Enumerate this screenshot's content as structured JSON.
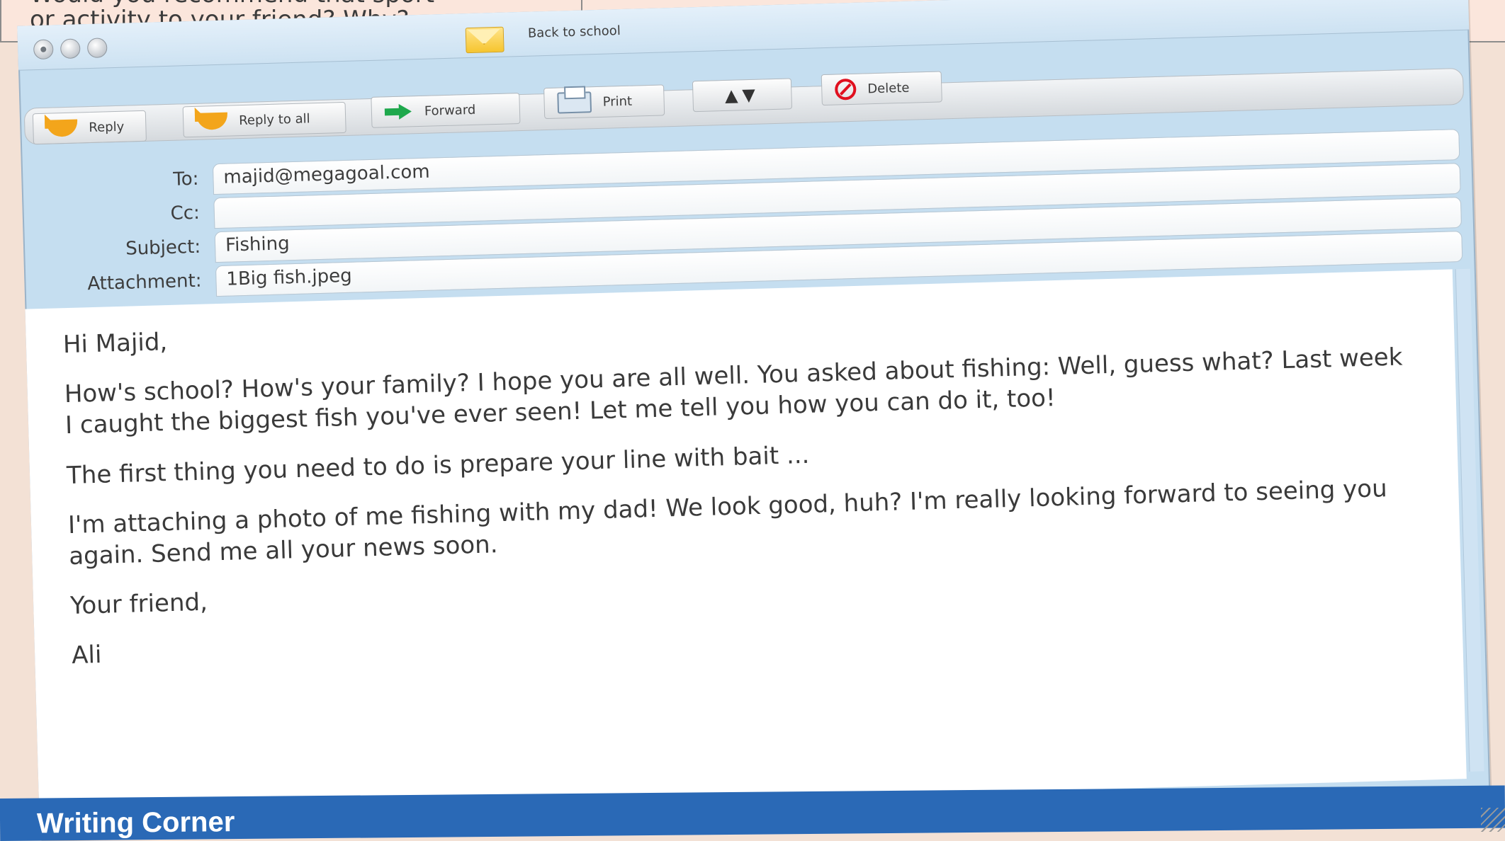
{
  "question": {
    "line1": "Would you recommend that sport",
    "line2": "or activity to your friend? Why?"
  },
  "window": {
    "title": "Back to school"
  },
  "toolbar": {
    "reply": "Reply",
    "reply_all": "Reply to all",
    "forward": "Forward",
    "print": "Print",
    "updown_glyph": "▲▼",
    "delete": "Delete"
  },
  "fields": {
    "to_label": "To:",
    "to_value": "majid@megagoal.com",
    "cc_label": "Cc:",
    "cc_value": "",
    "subject_label": "Subject:",
    "subject_value": "Fishing",
    "attachment_label": "Attachment:",
    "attachment_value": "1Big fish.jpeg"
  },
  "message": {
    "greeting": "Hi Majid,",
    "p1": "How's school? How's your family? I hope you are all well. You asked about fishing: Well, guess what? Last week I caught the biggest fish you've ever seen! Let me tell you how you can do it, too!",
    "p2": "The first thing you need to do is prepare your line with bait ...",
    "p3": "I'm attaching a photo of me fishing with my dad! We look good, huh? I'm really looking forward to seeing you again. Send me all your news soon.",
    "closing": "Your friend,",
    "signature": "Ali"
  },
  "footer": {
    "section_title": "Writing Corner"
  },
  "colors": {
    "page_bg": "#f3e1d5",
    "window_frame": "#c5def0",
    "footer_band": "#2a69b6",
    "reply_icon": "#f3a51b",
    "forward_icon": "#1ea84c",
    "delete_icon": "#e0101f"
  },
  "icons": [
    "envelope-icon",
    "reply-icon",
    "reply-all-icon",
    "forward-icon",
    "print-icon",
    "up-down-arrows-icon",
    "delete-icon"
  ]
}
